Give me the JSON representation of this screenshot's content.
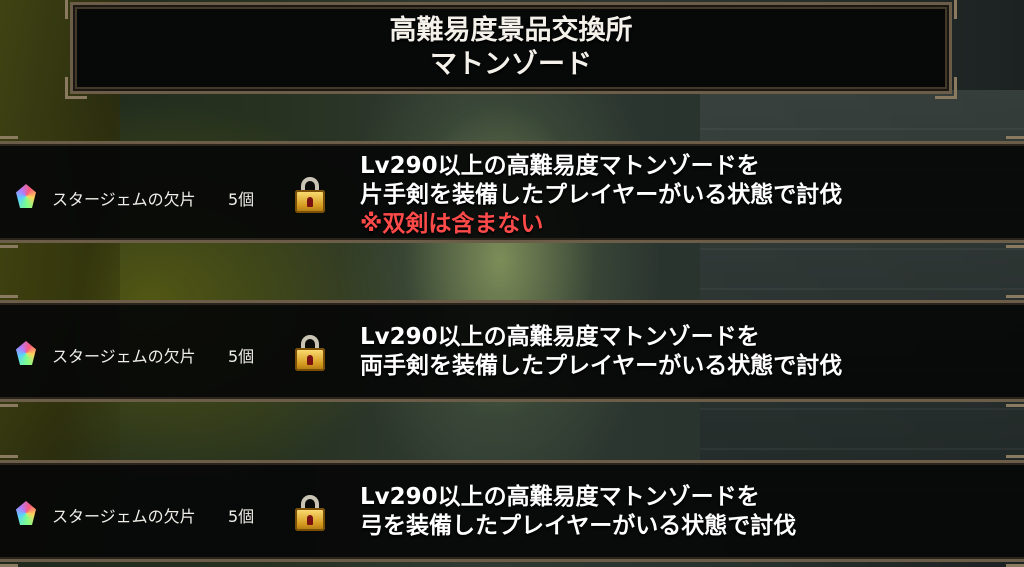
{
  "header": {
    "title_line1": "高難易度景品交換所",
    "title_line2": "マトンゾード"
  },
  "rewards": [
    {
      "item_name": "スタージェムの欠片",
      "quantity": "5個",
      "icon": "star-gem-shard-icon",
      "locked": true,
      "condition_line1": "Lv290以上の高難易度マトンゾードを",
      "condition_line2": "片手剣を装備したプレイヤーがいる状態で討伐",
      "note": "※双剣は含まない"
    },
    {
      "item_name": "スタージェムの欠片",
      "quantity": "5個",
      "icon": "star-gem-shard-icon",
      "locked": true,
      "condition_line1": "Lv290以上の高難易度マトンゾードを",
      "condition_line2": "両手剣を装備したプレイヤーがいる状態で討伐"
    },
    {
      "item_name": "スタージェムの欠片",
      "quantity": "5個",
      "icon": "star-gem-shard-icon",
      "locked": true,
      "condition_line1": "Lv290以上の高難易度マトンゾードを",
      "condition_line2": "弓を装備したプレイヤーがいる状態で討伐"
    }
  ],
  "colors": {
    "frame_gold": "#6b5d48",
    "note_red": "#ff4a4a",
    "panel_bg": "#070808"
  }
}
